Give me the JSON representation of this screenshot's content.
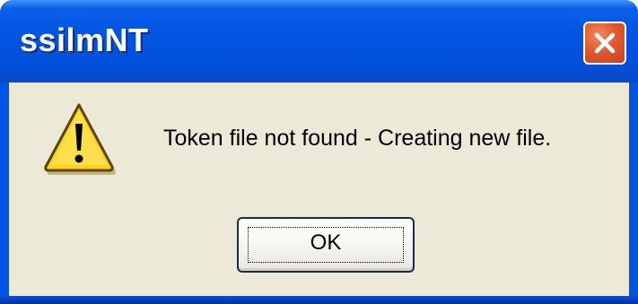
{
  "window": {
    "title": "ssilmNT"
  },
  "titlebar_buttons": {
    "close_icon": "close-x-icon"
  },
  "dialog": {
    "icon": "warning-icon",
    "message": "Token file not found - Creating new file.",
    "ok_label": "OK"
  },
  "colors": {
    "titlebar": "#0354e2",
    "client_background": "#ece9d8",
    "close_button": "#e15a2f",
    "warning_yellow": "#ffd21f"
  }
}
